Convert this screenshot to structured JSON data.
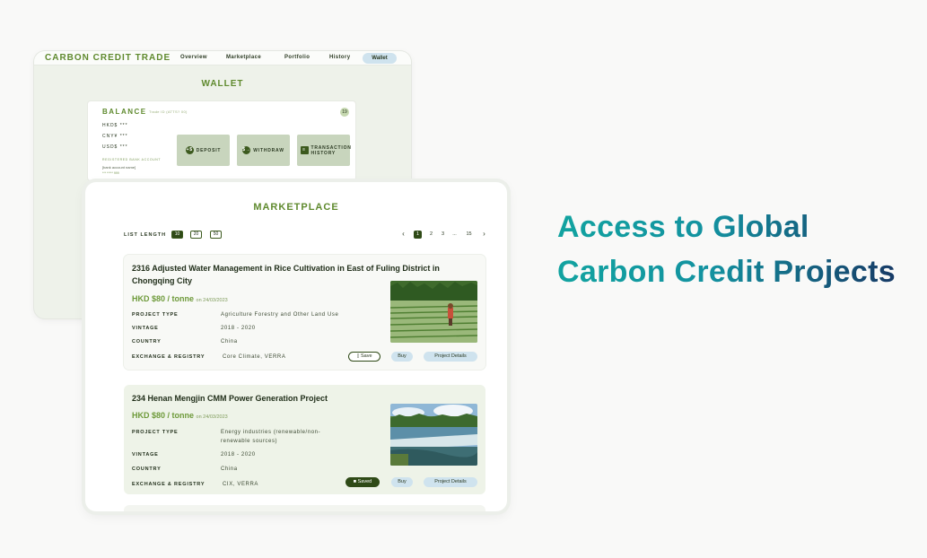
{
  "app": {
    "brand": "CARBON CREDIT TRADE",
    "nav": [
      "Overview",
      "Marketplace",
      "Portfolio",
      "History",
      "Wallet"
    ],
    "active_nav": "Wallet"
  },
  "wallet": {
    "title": "WALLET",
    "balance_label": "BALANCE",
    "balance_sub": "Trade ID (ATTS? 00)",
    "eye_icon": "19",
    "lines": [
      "HKD$ ***",
      "CNY¥ ***",
      "USD$ ***"
    ],
    "bank_label": "REGISTERED BANK ACCOUNT",
    "bank_name": "[bank account name]",
    "bank_acct": "*** ***** 999",
    "buttons": [
      {
        "icon": "+$",
        "label": "DEPOSIT"
      },
      {
        "icon": "$→",
        "label": "WITHDRAW"
      },
      {
        "icon": "≡",
        "label": "TRANSACTION HISTORY"
      }
    ]
  },
  "marketplace": {
    "title": "MARKETPLACE",
    "list_length_label": "LIST LENGTH",
    "list_length_options": [
      "10",
      "20",
      "50"
    ],
    "list_length_selected": "10",
    "pagination": {
      "prev": "‹",
      "pages": [
        "1",
        "2",
        "3",
        "...",
        "15"
      ],
      "active": "1",
      "next": "›"
    },
    "projects": [
      {
        "title": "2316 Adjusted Water Management in Rice Cultivation in East of Fuling District in Chongqing City",
        "price": "HKD $80 / tonne",
        "price_date": "on 24/03/2023",
        "fields": [
          {
            "key": "PROJECT TYPE",
            "value": "Agriculture Forestry and Other Land Use"
          },
          {
            "key": "VINTAGE",
            "value": "2018 - 2020"
          },
          {
            "key": "COUNTRY",
            "value": "China"
          },
          {
            "key": "EXCHANGE & REGISTRY",
            "value": "Core Climate, VERRA"
          }
        ],
        "save_label": "Save",
        "saved": false,
        "buy_label": "Buy",
        "details_label": "Project Details"
      },
      {
        "title": "234 Henan Mengjin CMM Power Generation Project",
        "price": "HKD $80 / tonne",
        "price_date": "on 24/03/2023",
        "fields": [
          {
            "key": "PROJECT TYPE",
            "value": "Energy industries (renewable/non-renewable sources)"
          },
          {
            "key": "VINTAGE",
            "value": "2018 - 2020"
          },
          {
            "key": "COUNTRY",
            "value": "China"
          },
          {
            "key": "EXCHANGE & REGISTRY",
            "value": "CIX, VERRA"
          }
        ],
        "save_label": "Saved",
        "saved": true,
        "buy_label": "Buy",
        "details_label": "Project Details"
      }
    ]
  },
  "headline": {
    "line1": "Access to Global",
    "line2": "Carbon Credit Projects"
  }
}
